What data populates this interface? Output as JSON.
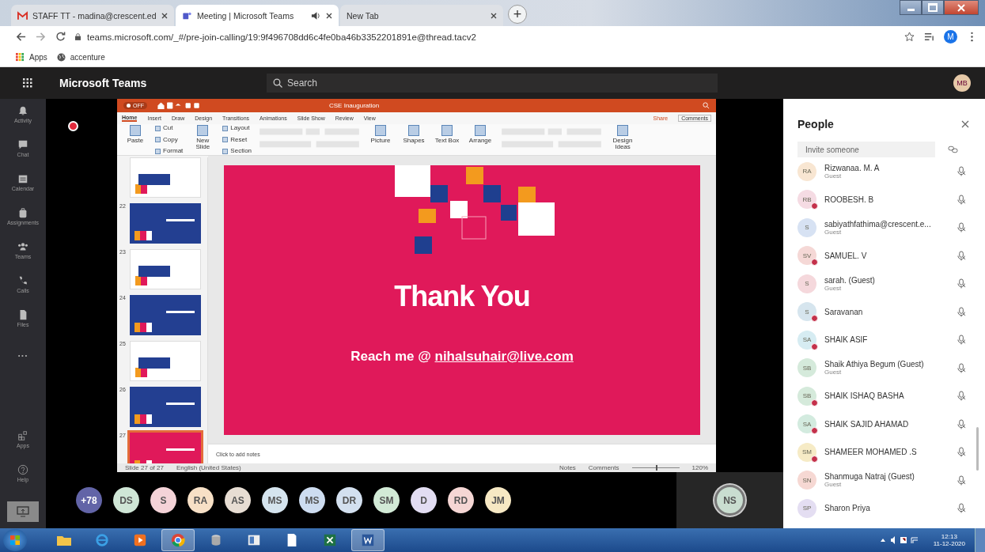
{
  "browser": {
    "tabs": [
      {
        "title": "STAFF TT - madina@crescent.ed",
        "kind": "mail",
        "selected": false,
        "audio": false
      },
      {
        "title": "Meeting | Microsoft Teams",
        "kind": "teams",
        "selected": true,
        "audio": true
      },
      {
        "title": "New Tab",
        "kind": "blank",
        "selected": false,
        "audio": false
      }
    ],
    "new_tab": "+",
    "url": "teams.microsoft.com/_#/pre-join-calling/19:9f496708dd6c4fe0ba46b3352201891e@thread.tacv2",
    "profile": "M",
    "bookmarks": [
      {
        "label": "Apps",
        "kind": "apps"
      },
      {
        "label": "accenture",
        "kind": "globe"
      }
    ]
  },
  "teams": {
    "title": "Microsoft Teams",
    "search": {
      "placeholder": "Search"
    },
    "user": "MB",
    "rail": [
      {
        "label": "Activity",
        "kind": "bell"
      },
      {
        "label": "Chat",
        "kind": "chat"
      },
      {
        "label": "Calendar",
        "kind": "calendar"
      },
      {
        "label": "Assignments",
        "kind": "bag"
      },
      {
        "label": "Teams",
        "kind": "teams"
      },
      {
        "label": "Calls",
        "kind": "phone"
      },
      {
        "label": "Files",
        "kind": "file"
      },
      {
        "label": "...",
        "kind": "more"
      }
    ],
    "rail_bottom": [
      {
        "label": "Apps",
        "kind": "apps"
      },
      {
        "label": "Help",
        "kind": "help"
      }
    ]
  },
  "ppt": {
    "autosave": "OFF",
    "title": "CSE Inauguration",
    "tabs": [
      {
        "label": "Home",
        "selected": true
      },
      {
        "label": "Insert",
        "selected": false
      },
      {
        "label": "Draw",
        "selected": false
      },
      {
        "label": "Design",
        "selected": false
      },
      {
        "label": "Transitions",
        "selected": false
      },
      {
        "label": "Animations",
        "selected": false
      },
      {
        "label": "Slide Show",
        "selected": false
      },
      {
        "label": "Review",
        "selected": false
      },
      {
        "label": "View",
        "selected": false
      }
    ],
    "share": "Share",
    "comments": "Comments",
    "ribbon": [
      {
        "kind": "large",
        "label": "Paste"
      },
      {
        "kind": "stack",
        "items": [
          "Cut",
          "Copy",
          "Format"
        ]
      },
      {
        "kind": "large",
        "label": "New Slide"
      },
      {
        "kind": "stack",
        "items": [
          "Layout",
          "Reset",
          "Section"
        ]
      },
      {
        "kind": "controls"
      },
      {
        "kind": "large",
        "label": "Picture"
      },
      {
        "kind": "large",
        "label": "Shapes"
      },
      {
        "kind": "large",
        "label": "Text Box"
      },
      {
        "kind": "large",
        "label": "Arrange"
      },
      {
        "kind": "controls"
      },
      {
        "kind": "large",
        "label": "Design Ideas"
      }
    ],
    "thumbnails": [
      {
        "kind": "white",
        "selected": false
      },
      {
        "number": "22",
        "kind": "blue",
        "selected": false
      },
      {
        "number": "23",
        "kind": "white",
        "selected": false
      },
      {
        "number": "24",
        "kind": "blue",
        "selected": false
      },
      {
        "number": "25",
        "kind": "white",
        "selected": false
      },
      {
        "number": "26",
        "kind": "blue",
        "selected": false
      },
      {
        "number": "27",
        "kind": "pink",
        "selected": true
      }
    ],
    "slide": {
      "title": "Thank You",
      "contact_prefix": "Reach me @ ",
      "email": "nihalsuhair@live.com"
    },
    "notes_placeholder": "Click to add notes",
    "status": {
      "slide": "Slide 27 of 27",
      "language": "English (United States)",
      "notes": "Notes",
      "comments": "Comments",
      "zoom": {
        "level": 0.5,
        "reading": "120%"
      }
    }
  },
  "call": {
    "participants": [
      {
        "initials": "+78",
        "color": "#6264a7"
      },
      {
        "initials": "DS",
        "color": "#cfe6d6"
      },
      {
        "initials": "S",
        "color": "#f4d3d8"
      },
      {
        "initials": "RA",
        "color": "#f7e0c6"
      },
      {
        "initials": "AS",
        "color": "#e7ddd3"
      },
      {
        "initials": "MS",
        "color": "#d5e4ee"
      },
      {
        "initials": "MS",
        "color": "#cddcf0"
      },
      {
        "initials": "DR",
        "color": "#d3e0ef"
      },
      {
        "initials": "SM",
        "color": "#d2ead6"
      },
      {
        "initials": "D",
        "color": "#e2ddf2"
      },
      {
        "initials": "RD",
        "color": "#f5d6d4"
      },
      {
        "initials": "JM",
        "color": "#f6e8c3"
      }
    ],
    "self": {
      "initials": "NS"
    }
  },
  "people": {
    "title": "People",
    "invite": {
      "placeholder": "Invite someone"
    },
    "list": [
      {
        "initials": "RA",
        "name": "Rizwanaa. M. A",
        "role": "Guest",
        "busy": false,
        "color": "#f8e6d2"
      },
      {
        "initials": "RB",
        "name": "ROOBESH. B",
        "busy": true,
        "color": "#f5dbe3"
      },
      {
        "initials": "S",
        "name": "sabiyathfathima@crescent.e...",
        "role": "Guest",
        "busy": false,
        "color": "#d7e2f3"
      },
      {
        "initials": "SV",
        "name": "SAMUEL. V",
        "busy": true,
        "color": "#f5d8d6"
      },
      {
        "initials": "S",
        "name": "sarah. (Guest)",
        "role": "Guest",
        "busy": false,
        "color": "#f5d8dc"
      },
      {
        "initials": "S",
        "name": "Saravanan",
        "busy": true,
        "color": "#d6e5ee"
      },
      {
        "initials": "SA",
        "name": "SHAIK ASIF",
        "busy": true,
        "color": "#d6ecf2"
      },
      {
        "initials": "SB",
        "name": "Shaik Athiya Begum (Guest)",
        "role": "Guest",
        "busy": false,
        "color": "#d5eadb"
      },
      {
        "initials": "SB",
        "name": "SHAIK ISHAQ BASHA",
        "busy": true,
        "color": "#d5eadb"
      },
      {
        "initials": "SA",
        "name": "SHAIK SAJID AHAMAD",
        "busy": true,
        "color": "#d3ebdf"
      },
      {
        "initials": "SM",
        "name": "SHAMEER MOHAMED .S",
        "busy": true,
        "color": "#f6ebc6"
      },
      {
        "initials": "SN",
        "name": "Shanmuga Natraj (Guest)",
        "role": "Guest",
        "busy": false,
        "color": "#f6d8d3"
      },
      {
        "initials": "SP",
        "name": "Sharon Priya",
        "busy": false,
        "color": "#e4def2"
      }
    ]
  },
  "taskbar": {
    "apps": [
      {
        "kind": "folder",
        "selected": false
      },
      {
        "kind": "ie",
        "selected": false
      },
      {
        "kind": "media",
        "selected": false
      },
      {
        "kind": "chrome",
        "selected": true
      },
      {
        "kind": "disk",
        "selected": false
      },
      {
        "kind": "window",
        "selected": false
      },
      {
        "kind": "doc",
        "selected": false
      },
      {
        "kind": "excel",
        "selected": false
      },
      {
        "kind": "word",
        "selected": true
      }
    ],
    "time": "12:13",
    "date": "11-12-2020"
  }
}
